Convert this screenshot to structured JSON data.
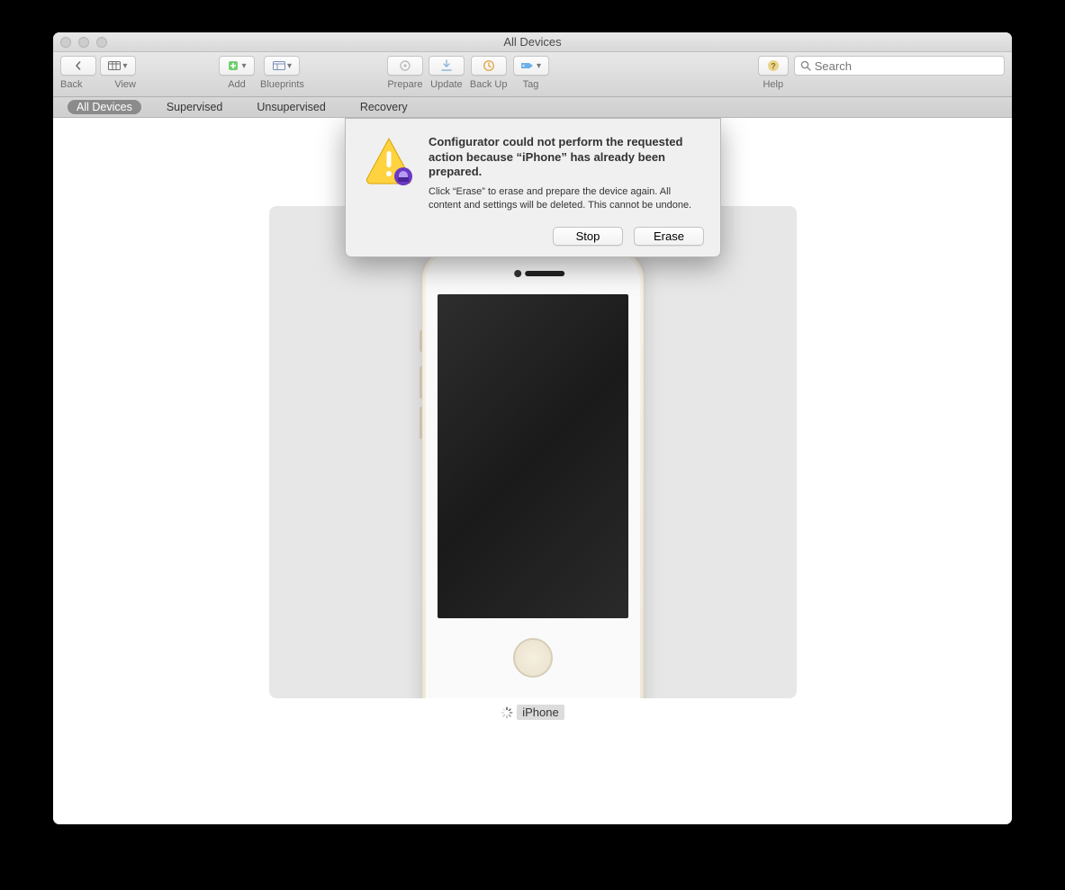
{
  "window": {
    "title": "All Devices"
  },
  "toolbar": {
    "back_label": "Back",
    "view_label": "View",
    "add_label": "Add",
    "blueprints_label": "Blueprints",
    "prepare_label": "Prepare",
    "update_label": "Update",
    "backup_label": "Back Up",
    "tag_label": "Tag",
    "help_label": "Help"
  },
  "search": {
    "placeholder": "Search"
  },
  "scopebar": {
    "items": [
      {
        "label": "All Devices",
        "active": true
      },
      {
        "label": "Supervised",
        "active": false
      },
      {
        "label": "Unsupervised",
        "active": false
      },
      {
        "label": "Recovery",
        "active": false
      }
    ]
  },
  "device": {
    "name": "iPhone"
  },
  "dialog": {
    "title": "Configurator could not perform the requested action because “iPhone” has already been prepared.",
    "description": "Click “Erase” to erase and prepare the device again. All content and settings will be deleted. This cannot be undone.",
    "stop_label": "Stop",
    "erase_label": "Erase"
  }
}
